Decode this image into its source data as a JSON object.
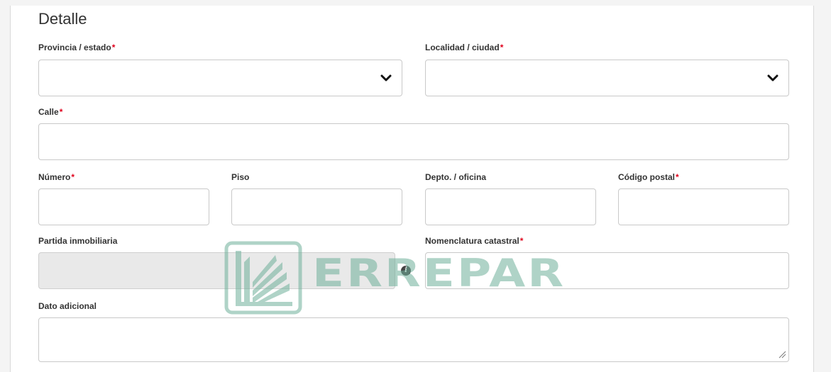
{
  "section": {
    "title": "Detalle"
  },
  "fields": {
    "provincia": {
      "label": "Provincia / estado",
      "required": "*",
      "value": ""
    },
    "localidad": {
      "label": "Localidad / ciudad",
      "required": "*",
      "value": ""
    },
    "calle": {
      "label": "Calle",
      "required": "*",
      "value": ""
    },
    "numero": {
      "label": "Número",
      "required": "*",
      "value": ""
    },
    "piso": {
      "label": "Piso",
      "value": ""
    },
    "depto": {
      "label": "Depto. / oficina",
      "value": ""
    },
    "codigo_postal": {
      "label": "Código postal",
      "required": "*",
      "value": ""
    },
    "partida": {
      "label": "Partida inmobiliaria",
      "value": ""
    },
    "nomenclatura": {
      "label": "Nomenclatura catastral",
      "required": "*",
      "value": ""
    },
    "dato_adicional": {
      "label": "Dato adicional",
      "value": ""
    }
  },
  "watermark": {
    "text": "ERREPAR"
  },
  "icons": {
    "select_chevron": "chevron-down-icon",
    "info": "info-icon",
    "resize": "resize-handle-icon"
  },
  "colors": {
    "required_mark": "#e0001b",
    "border": "#c9c9c9",
    "disabled_bg": "#e9e9e9",
    "watermark": "#6fb09a"
  }
}
